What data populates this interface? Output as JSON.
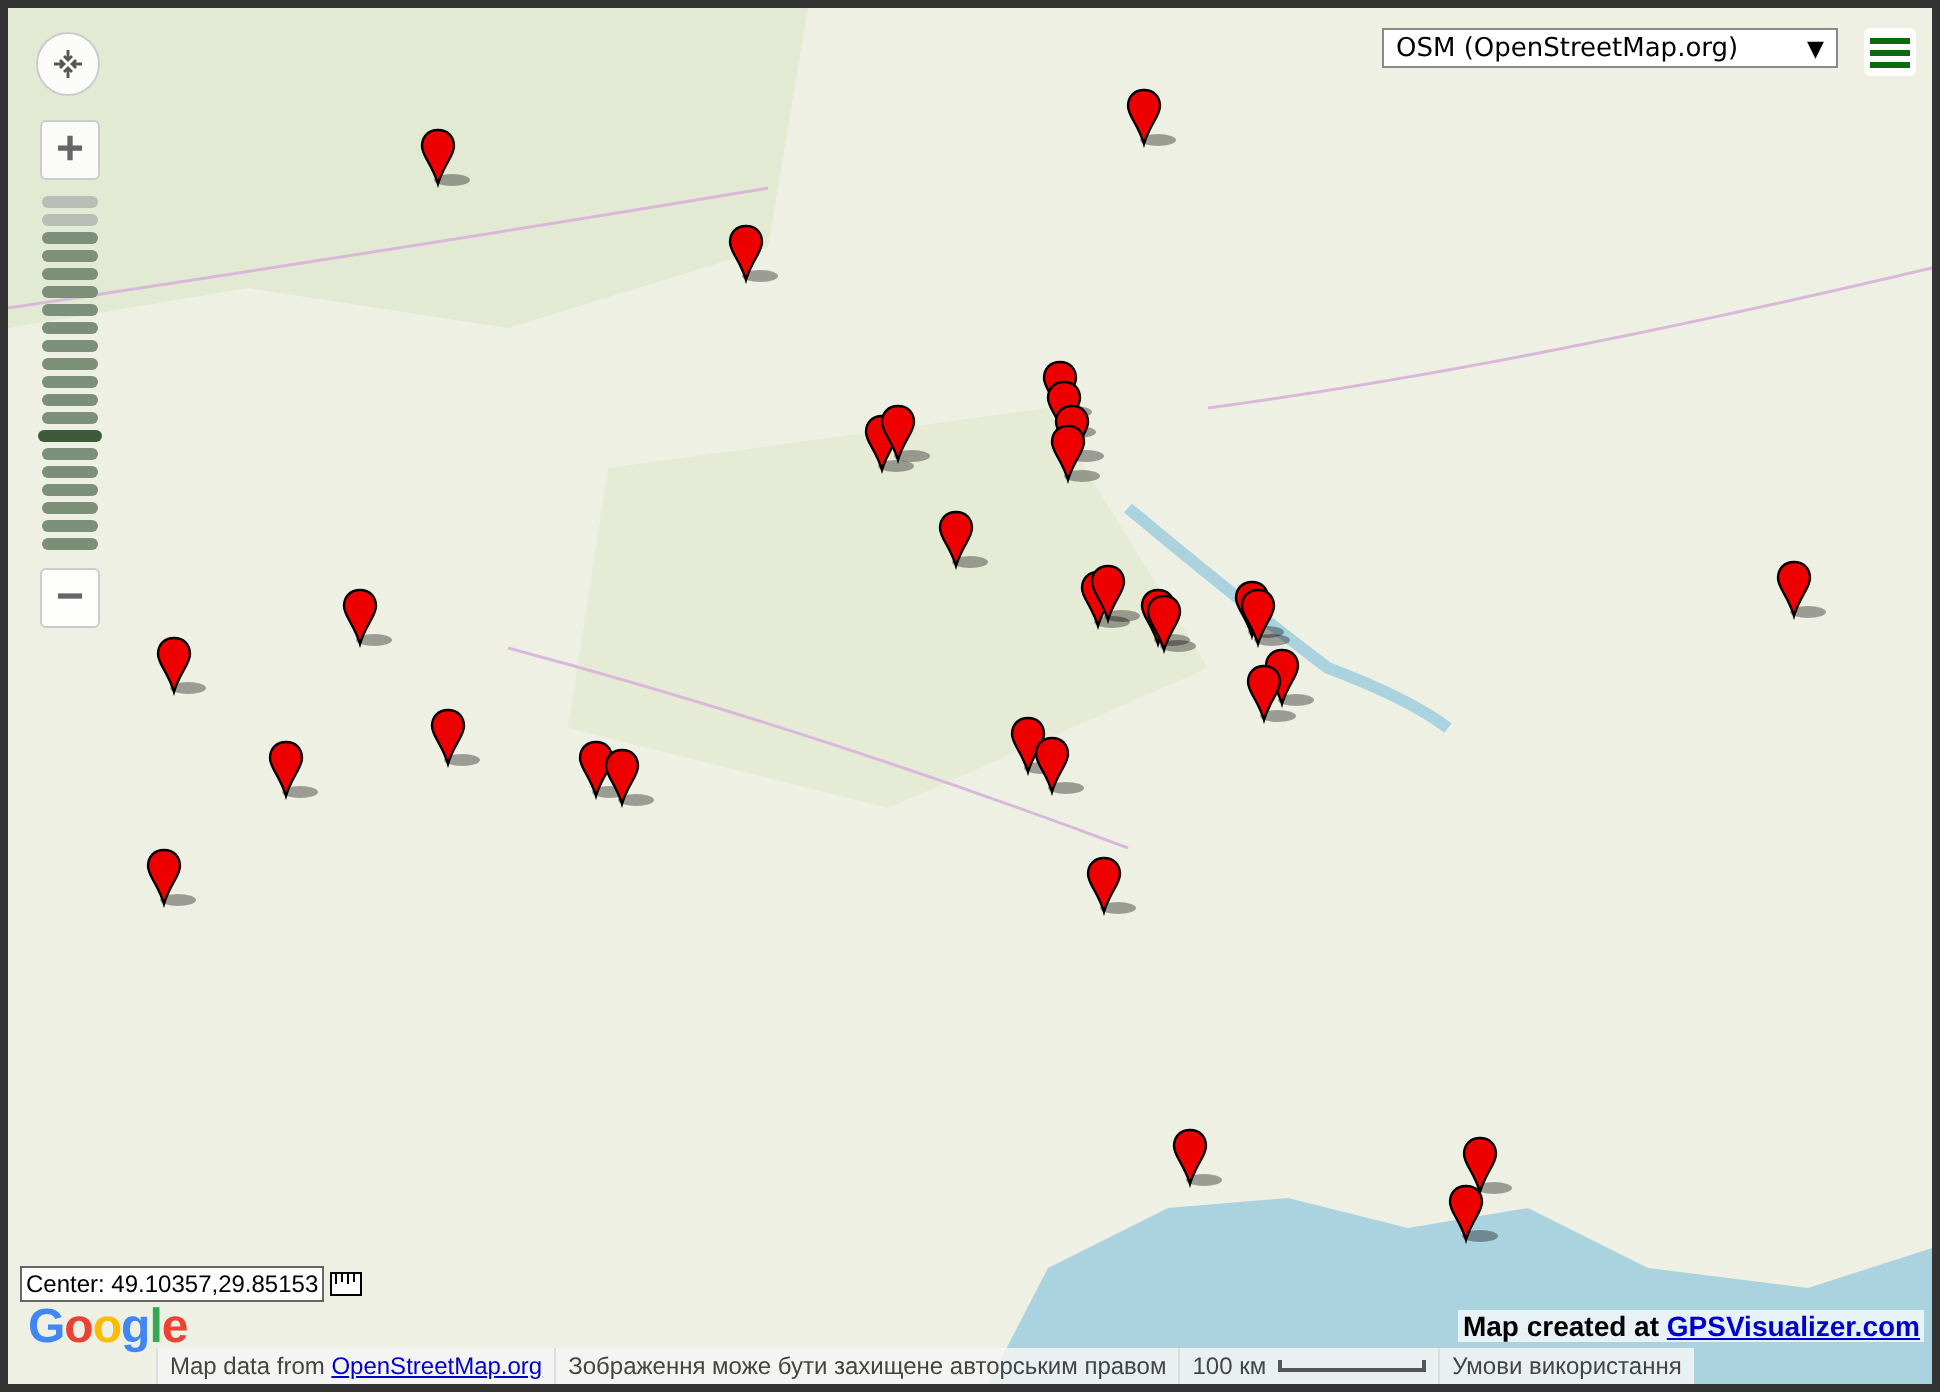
{
  "map_type_select": {
    "value": "OSM (OpenStreetMap.org)",
    "caret": "▼"
  },
  "zoom_controls": {
    "zoom_in": "+",
    "zoom_out": "−",
    "level": 0.3
  },
  "center_readout": "Center: 49.10357,29.85153",
  "credit": {
    "prefix": "Map created at ",
    "link": "GPSVisualizer.com"
  },
  "google_logo": "Google",
  "attribution": {
    "prefix": "Map data from ",
    "link": "OpenStreetMap.org",
    "copyright": "Зображення може бути захищене авторським правом",
    "scale": "100 км",
    "terms": "Умови використання"
  }
}
